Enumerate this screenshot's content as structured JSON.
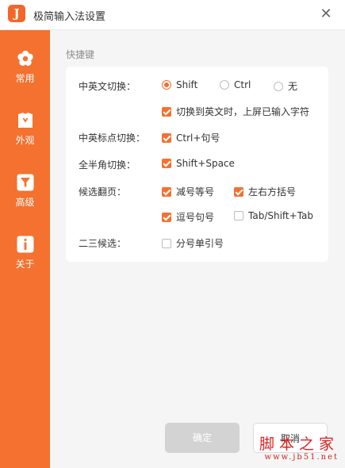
{
  "window": {
    "title": "极简输入法设置",
    "logo": "J"
  },
  "sidebar": {
    "items": [
      {
        "label": "常用",
        "icon": "flower-icon"
      },
      {
        "label": "外观",
        "icon": "shirt-icon"
      },
      {
        "label": "高级",
        "icon": "funnel-icon",
        "selected": true
      },
      {
        "label": "关于",
        "icon": "info-icon"
      }
    ]
  },
  "section": {
    "title": "快捷键"
  },
  "settings": {
    "cn_en_switch": {
      "label": "中英文切换：",
      "options": [
        {
          "label": "Shift",
          "selected": true
        },
        {
          "label": "Ctrl",
          "selected": false
        },
        {
          "label": "无",
          "selected": false
        }
      ],
      "commit_on_switch": {
        "label": "切换到英文时，上屏已输入字符",
        "checked": true
      }
    },
    "punct_switch": {
      "label": "中英标点切换：",
      "option": {
        "label": "Ctrl+句号",
        "checked": true
      }
    },
    "width_switch": {
      "label": "全半角切换：",
      "option": {
        "label": "Shift+Space",
        "checked": true
      }
    },
    "paging": {
      "label": "候选翻页：",
      "options": [
        {
          "label": "减号等号",
          "checked": true
        },
        {
          "label": "左右方括号",
          "checked": true
        },
        {
          "label": "逗号句号",
          "checked": true
        },
        {
          "label": "Tab/Shift+Tab",
          "checked": false
        }
      ]
    },
    "second_third": {
      "label": "二三候选：",
      "option": {
        "label": "分号单引号",
        "checked": false
      }
    }
  },
  "buttons": {
    "ok": "确定",
    "cancel": "取消"
  },
  "watermark": {
    "main": "脚本之家",
    "url": "www.jb51.net"
  },
  "colors": {
    "accent": "#f4712f",
    "panel_bg": "#f5f5f5",
    "disabled_button": "#d3d3d3"
  }
}
